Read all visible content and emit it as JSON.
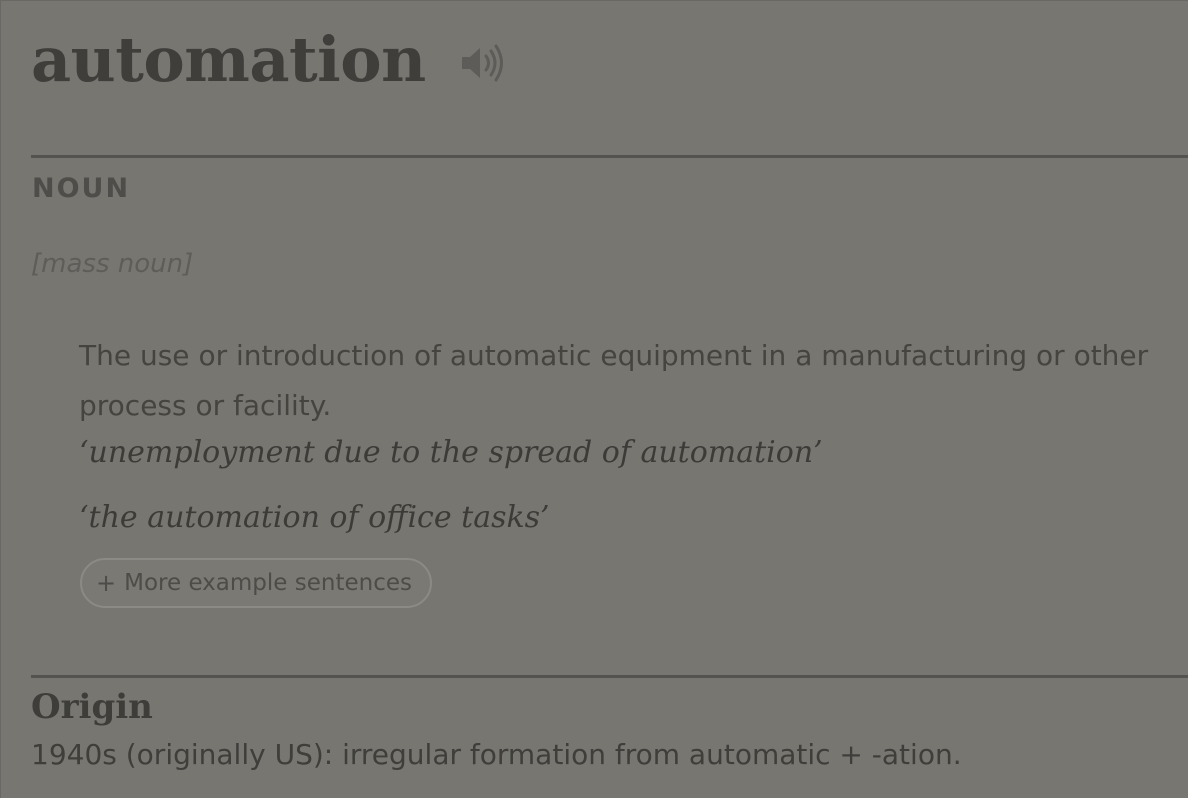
{
  "entry": {
    "headword": "automation",
    "audio_icon": "speaker-icon"
  },
  "sense": {
    "part_of_speech": "NOUN",
    "grammar_note": "[mass noun]",
    "definition": "The use or introduction of automatic equipment in a manufacturing or other process or facility.",
    "examples": [
      "‘unemployment due to the spread of automation’",
      "‘the automation of office tasks’"
    ],
    "more_examples": {
      "icon": "plus-icon",
      "plus": "+",
      "label": "More example sentences"
    }
  },
  "origin": {
    "title": "Origin",
    "text": "1940s (originally US): irregular formation from automatic + -ation."
  },
  "colors": {
    "background": "#787671",
    "text": "#3b3a37",
    "rule": "#55534f"
  }
}
